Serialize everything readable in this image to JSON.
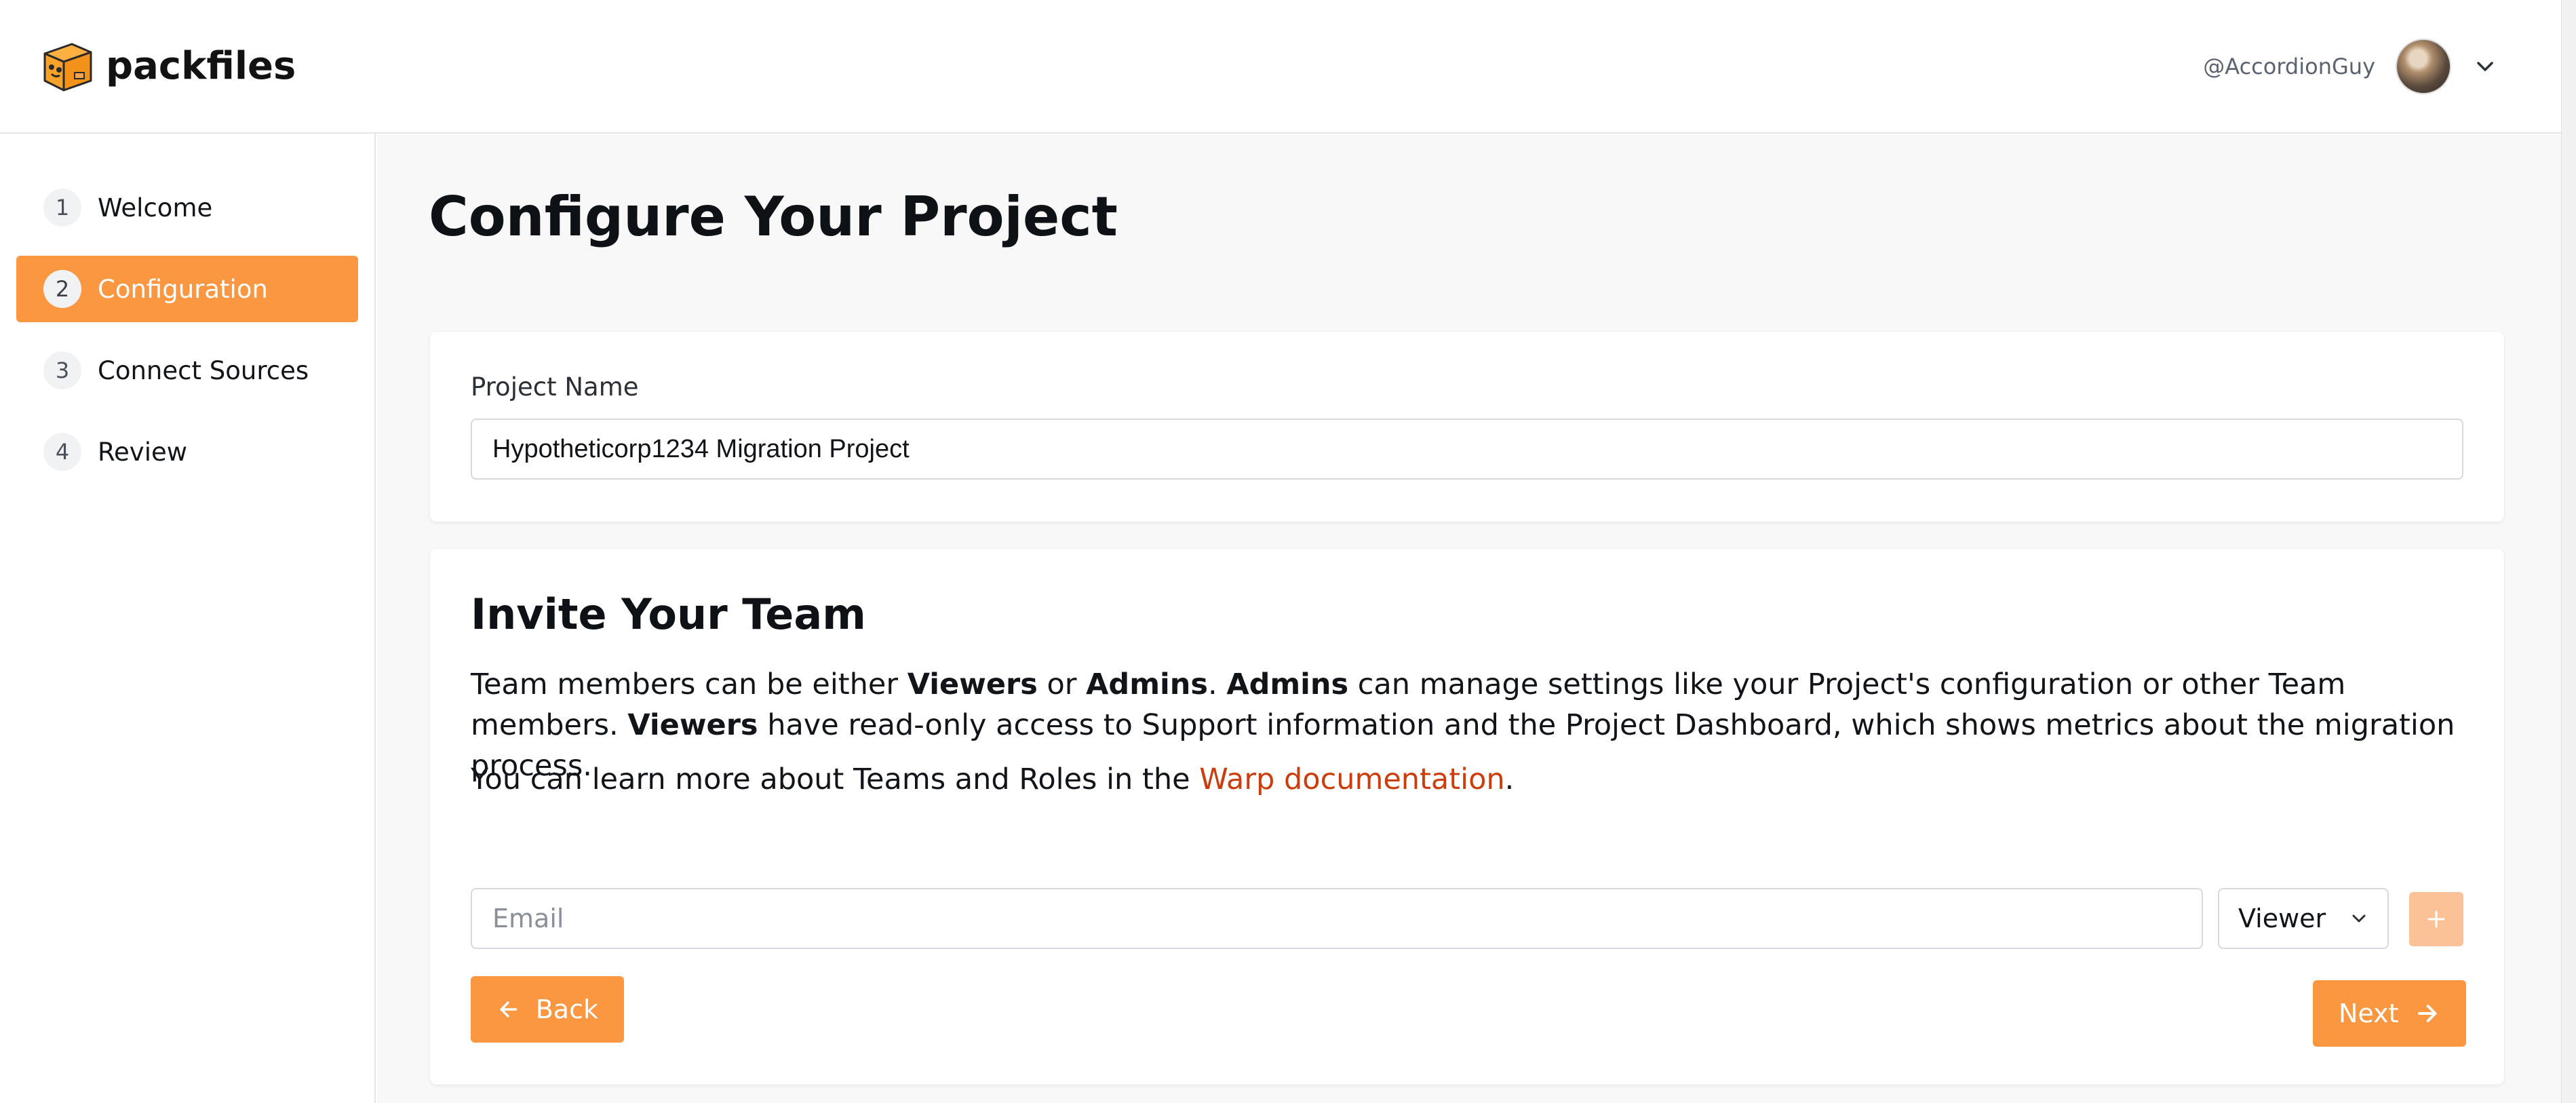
{
  "header": {
    "brand_name": "packfiles",
    "username": "@AccordionGuy"
  },
  "sidebar": {
    "steps": [
      {
        "num": "1",
        "label": "Welcome",
        "active": false
      },
      {
        "num": "2",
        "label": "Configuration",
        "active": true
      },
      {
        "num": "3",
        "label": "Connect Sources",
        "active": false
      },
      {
        "num": "4",
        "label": "Review",
        "active": false
      }
    ]
  },
  "main": {
    "title": "Configure Your Project",
    "project": {
      "label": "Project Name",
      "value": "Hypotheticorp1234 Migration Project"
    },
    "team": {
      "title": "Invite Your Team",
      "desc_1": "Team members can be either ",
      "viewers": "Viewers",
      "or": " or ",
      "admins": "Admins",
      "period": ".",
      "desc_2": " can manage settings like your Project's configuration or other Team members. ",
      "desc_3": " have read-only access to Support information and the Project Dashboard, which shows metrics about the migration process.",
      "learn_prefix": "You can learn more about Teams and Roles in the ",
      "learn_link": "Warp documentation",
      "learn_suffix": ".",
      "email_placeholder": "Email",
      "role_selected": "Viewer"
    },
    "buttons": {
      "back": "Back",
      "next": "Next"
    }
  },
  "colors": {
    "accent": "#fb9740",
    "accent_light": "#fcc297",
    "link": "#cc3d0c"
  },
  "icons": {
    "logo": "box-mascot-icon",
    "chevron": "chevron-down-icon",
    "plus": "plus-icon",
    "back": "arrow-left-icon",
    "next": "arrow-right-icon"
  }
}
